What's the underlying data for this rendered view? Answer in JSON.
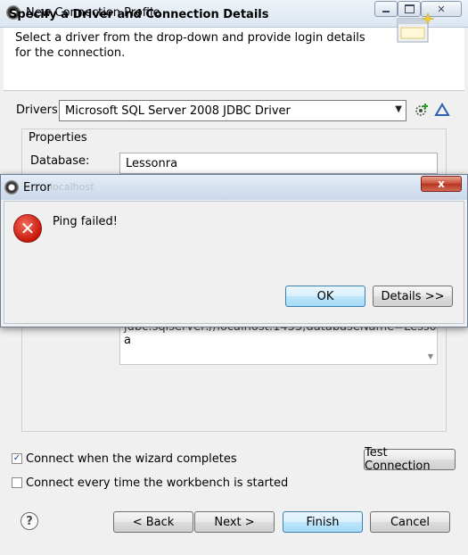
{
  "window": {
    "title": "New Connection Profile",
    "close_glyph": "✕"
  },
  "banner": {
    "title": "Specify a Driver and Connection Details",
    "description": "Select a driver from the drop-down and provide login details for the connection."
  },
  "drivers": {
    "label": "Drivers:",
    "selected": "Microsoft SQL Server 2008 JDBC Driver"
  },
  "properties": {
    "title": "Properties",
    "database_label": "Database:",
    "database_value": "Lessonra",
    "url_partial_line": "jdbc:sqlserver://localhost:1433;databaseName=Lesson",
    "url_last_line": "a"
  },
  "options": {
    "connect_on_finish": {
      "label": "Connect when the wizard completes",
      "checked": true
    },
    "connect_on_start": {
      "label": "Connect every time the workbench is started",
      "checked": false
    }
  },
  "buttons": {
    "test_connection": "Test Connection",
    "back": "< Back",
    "next": "Next >",
    "finish": "Finish",
    "cancel": "Cancel",
    "help": "?"
  },
  "error_dialog": {
    "title": "Error",
    "ghost_text": "localhost",
    "close_glyph": "x",
    "icon_glyph": "✕",
    "message": "Ping failed!",
    "ok": "OK",
    "details": "Details >>"
  },
  "icons": {
    "app": "eclipse-icon",
    "error": "error-icon",
    "help": "help-icon",
    "new_driver": "new-driver-icon",
    "edit_driver": "edit-driver-icon"
  }
}
